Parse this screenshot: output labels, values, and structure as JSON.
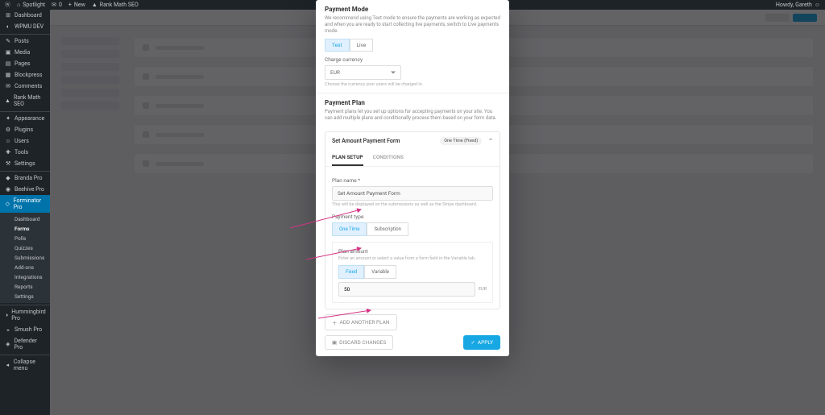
{
  "adminbar": {
    "site": "Spotlight",
    "comments": "0",
    "new": "New",
    "rankmath": "Rank Math SEO",
    "howdy": "Howdy, Gareth"
  },
  "sidebar": {
    "items": [
      {
        "icon": "⊞",
        "label": "Dashboard"
      },
      {
        "icon": "◐",
        "label": "WPMU DEV"
      },
      {
        "icon": "✎",
        "label": "Posts",
        "sep": true
      },
      {
        "icon": "▣",
        "label": "Media"
      },
      {
        "icon": "▤",
        "label": "Pages"
      },
      {
        "icon": "▦",
        "label": "Blockpress"
      },
      {
        "icon": "✉",
        "label": "Comments"
      },
      {
        "icon": "▲",
        "label": "Rank Math SEO"
      },
      {
        "icon": "✦",
        "label": "Appearance",
        "sep": true
      },
      {
        "icon": "⚙",
        "label": "Plugins"
      },
      {
        "icon": "☺",
        "label": "Users"
      },
      {
        "icon": "✚",
        "label": "Tools"
      },
      {
        "icon": "⚒",
        "label": "Settings"
      },
      {
        "icon": "◆",
        "label": "Branda Pro",
        "sep": true
      },
      {
        "icon": "◉",
        "label": "Beehive Pro"
      },
      {
        "icon": "◇",
        "label": "Forminator Pro",
        "current": true
      },
      {
        "icon": "◑",
        "label": "Hummingbird Pro",
        "sep": true
      },
      {
        "icon": "◒",
        "label": "Smush Pro"
      },
      {
        "icon": "◈",
        "label": "Defender Pro"
      },
      {
        "icon": "◂",
        "label": "Collapse menu",
        "sep": true
      }
    ],
    "submenu": [
      "Dashboard",
      "Forms",
      "Polls",
      "Quizzes",
      "Submissions",
      "Add-ons",
      "Integrations",
      "Reports",
      "Settings"
    ],
    "submenu_active": "Forms"
  },
  "modal": {
    "mode_title": "Payment Mode",
    "mode_desc": "We recommend using Test mode to ensure the payments are working as expected and when you are ready to start collecting live payments, switch to Live payments mode.",
    "mode_tabs": {
      "test": "Test",
      "live": "Live"
    },
    "currency_label": "Charge currency",
    "currency_value": "EUR",
    "currency_help": "Choose the currency your users will be charged in.",
    "plan_title": "Payment Plan",
    "plan_desc": "Payment plans let you set up options for accepting payments on your site. You can add multiple plans and conditionally process them based on your form data.",
    "plan_head": "Set Amount Payment Form",
    "plan_badge": "One Time (Fixed)",
    "plan_subtabs": {
      "setup": "PLAN SETUP",
      "cond": "CONDITIONS"
    },
    "plan_name_label": "Plan name *",
    "plan_name_value": "Set Amount Payment Form",
    "plan_name_help": "This will be displayed on the submissions as well as the Stripe dashboard.",
    "pay_type_label": "Payment type",
    "pay_type": {
      "one": "One Time",
      "sub": "Subscription"
    },
    "amount_label": "Plan amount",
    "amount_help": "Enter an amount or select a value from a form field in the Variable tab.",
    "amount_tabs": {
      "fixed": "Fixed",
      "var": "Variable"
    },
    "amount_value": "50",
    "amount_currency": "EUR",
    "add_plan": "ADD ANOTHER PLAN",
    "discard": "DISCARD CHANGES",
    "apply": "APPLY"
  }
}
